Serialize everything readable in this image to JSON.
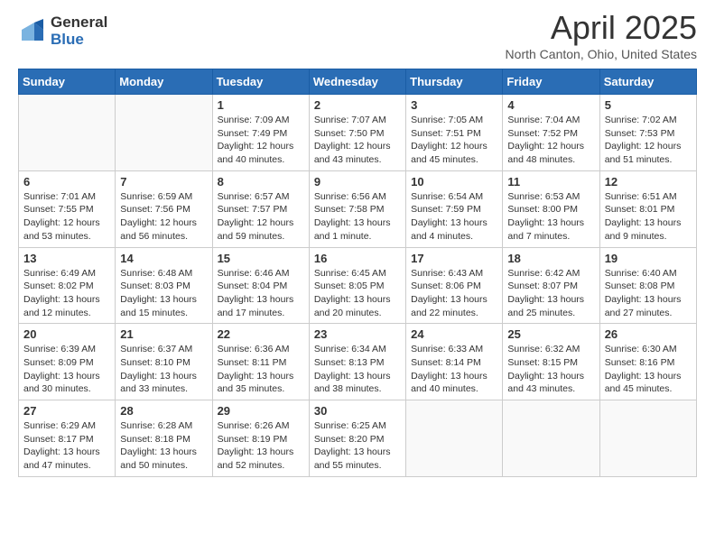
{
  "logo": {
    "general": "General",
    "blue": "Blue"
  },
  "title": "April 2025",
  "location": "North Canton, Ohio, United States",
  "weekdays": [
    "Sunday",
    "Monday",
    "Tuesday",
    "Wednesday",
    "Thursday",
    "Friday",
    "Saturday"
  ],
  "weeks": [
    [
      {
        "day": "",
        "info": ""
      },
      {
        "day": "",
        "info": ""
      },
      {
        "day": "1",
        "info": "Sunrise: 7:09 AM\nSunset: 7:49 PM\nDaylight: 12 hours and 40 minutes."
      },
      {
        "day": "2",
        "info": "Sunrise: 7:07 AM\nSunset: 7:50 PM\nDaylight: 12 hours and 43 minutes."
      },
      {
        "day": "3",
        "info": "Sunrise: 7:05 AM\nSunset: 7:51 PM\nDaylight: 12 hours and 45 minutes."
      },
      {
        "day": "4",
        "info": "Sunrise: 7:04 AM\nSunset: 7:52 PM\nDaylight: 12 hours and 48 minutes."
      },
      {
        "day": "5",
        "info": "Sunrise: 7:02 AM\nSunset: 7:53 PM\nDaylight: 12 hours and 51 minutes."
      }
    ],
    [
      {
        "day": "6",
        "info": "Sunrise: 7:01 AM\nSunset: 7:55 PM\nDaylight: 12 hours and 53 minutes."
      },
      {
        "day": "7",
        "info": "Sunrise: 6:59 AM\nSunset: 7:56 PM\nDaylight: 12 hours and 56 minutes."
      },
      {
        "day": "8",
        "info": "Sunrise: 6:57 AM\nSunset: 7:57 PM\nDaylight: 12 hours and 59 minutes."
      },
      {
        "day": "9",
        "info": "Sunrise: 6:56 AM\nSunset: 7:58 PM\nDaylight: 13 hours and 1 minute."
      },
      {
        "day": "10",
        "info": "Sunrise: 6:54 AM\nSunset: 7:59 PM\nDaylight: 13 hours and 4 minutes."
      },
      {
        "day": "11",
        "info": "Sunrise: 6:53 AM\nSunset: 8:00 PM\nDaylight: 13 hours and 7 minutes."
      },
      {
        "day": "12",
        "info": "Sunrise: 6:51 AM\nSunset: 8:01 PM\nDaylight: 13 hours and 9 minutes."
      }
    ],
    [
      {
        "day": "13",
        "info": "Sunrise: 6:49 AM\nSunset: 8:02 PM\nDaylight: 13 hours and 12 minutes."
      },
      {
        "day": "14",
        "info": "Sunrise: 6:48 AM\nSunset: 8:03 PM\nDaylight: 13 hours and 15 minutes."
      },
      {
        "day": "15",
        "info": "Sunrise: 6:46 AM\nSunset: 8:04 PM\nDaylight: 13 hours and 17 minutes."
      },
      {
        "day": "16",
        "info": "Sunrise: 6:45 AM\nSunset: 8:05 PM\nDaylight: 13 hours and 20 minutes."
      },
      {
        "day": "17",
        "info": "Sunrise: 6:43 AM\nSunset: 8:06 PM\nDaylight: 13 hours and 22 minutes."
      },
      {
        "day": "18",
        "info": "Sunrise: 6:42 AM\nSunset: 8:07 PM\nDaylight: 13 hours and 25 minutes."
      },
      {
        "day": "19",
        "info": "Sunrise: 6:40 AM\nSunset: 8:08 PM\nDaylight: 13 hours and 27 minutes."
      }
    ],
    [
      {
        "day": "20",
        "info": "Sunrise: 6:39 AM\nSunset: 8:09 PM\nDaylight: 13 hours and 30 minutes."
      },
      {
        "day": "21",
        "info": "Sunrise: 6:37 AM\nSunset: 8:10 PM\nDaylight: 13 hours and 33 minutes."
      },
      {
        "day": "22",
        "info": "Sunrise: 6:36 AM\nSunset: 8:11 PM\nDaylight: 13 hours and 35 minutes."
      },
      {
        "day": "23",
        "info": "Sunrise: 6:34 AM\nSunset: 8:13 PM\nDaylight: 13 hours and 38 minutes."
      },
      {
        "day": "24",
        "info": "Sunrise: 6:33 AM\nSunset: 8:14 PM\nDaylight: 13 hours and 40 minutes."
      },
      {
        "day": "25",
        "info": "Sunrise: 6:32 AM\nSunset: 8:15 PM\nDaylight: 13 hours and 43 minutes."
      },
      {
        "day": "26",
        "info": "Sunrise: 6:30 AM\nSunset: 8:16 PM\nDaylight: 13 hours and 45 minutes."
      }
    ],
    [
      {
        "day": "27",
        "info": "Sunrise: 6:29 AM\nSunset: 8:17 PM\nDaylight: 13 hours and 47 minutes."
      },
      {
        "day": "28",
        "info": "Sunrise: 6:28 AM\nSunset: 8:18 PM\nDaylight: 13 hours and 50 minutes."
      },
      {
        "day": "29",
        "info": "Sunrise: 6:26 AM\nSunset: 8:19 PM\nDaylight: 13 hours and 52 minutes."
      },
      {
        "day": "30",
        "info": "Sunrise: 6:25 AM\nSunset: 8:20 PM\nDaylight: 13 hours and 55 minutes."
      },
      {
        "day": "",
        "info": ""
      },
      {
        "day": "",
        "info": ""
      },
      {
        "day": "",
        "info": ""
      }
    ]
  ]
}
